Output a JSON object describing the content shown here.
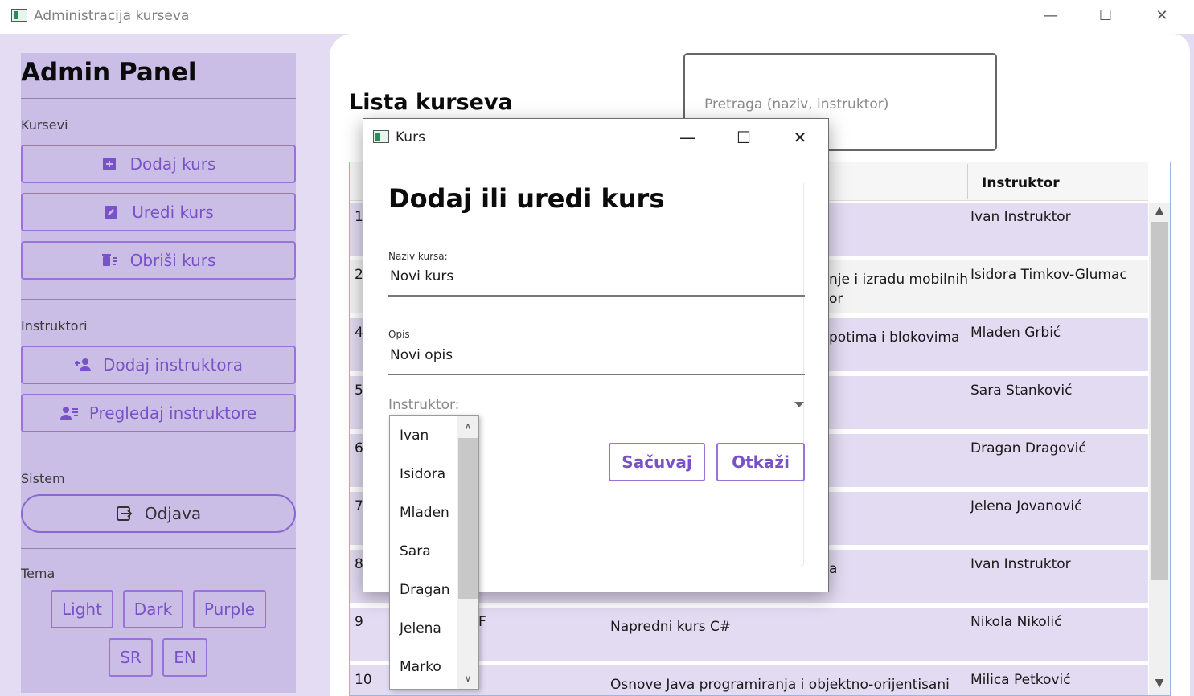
{
  "window": {
    "title": "Administracija kurseva",
    "minimize_glyph": "—",
    "maximize_glyph": "☐",
    "close_glyph": "✕"
  },
  "sidebar": {
    "title": "Admin Panel",
    "sections": {
      "courses": "Kursevi",
      "instructors": "Instruktori",
      "system": "Sistem",
      "theme": "Tema"
    },
    "buttons": {
      "add_course": "Dodaj kurs",
      "edit_course": "Uredi kurs",
      "delete_course": "Obriši kurs",
      "add_instructor": "Dodaj instruktora",
      "view_instructors": "Pregledaj instruktore",
      "logout": "Odjava"
    },
    "theme_buttons": [
      "Light",
      "Dark",
      "Purple"
    ],
    "language_buttons": [
      "SR",
      "EN"
    ],
    "icons": {
      "add_course": "plus-square-icon",
      "edit_course": "edit-icon",
      "delete_course": "delete-list-icon",
      "add_instructor": "person-add-icon",
      "view_instructors": "person-list-icon",
      "logout": "logout-icon"
    },
    "accent_color": "#7a52c8"
  },
  "main": {
    "list_title": "Lista kurseva",
    "search_placeholder": "Pretraga (naziv, instruktor)",
    "grid": {
      "instructor_header": "Instruktor",
      "rows": [
        {
          "id": "1",
          "course_fragment": "",
          "instructor": "Ivan Instruktor"
        },
        {
          "id": "2",
          "course_fragment": "nje i izradu mobilnih",
          "course_fragment2": "or",
          "instructor": "Isidora Timkov-Glumac"
        },
        {
          "id": "4",
          "course_fragment": "potima i blokovima",
          "instructor": "Mladen Grbić"
        },
        {
          "id": "5",
          "course_fragment": "",
          "instructor": "Sara Stanković"
        },
        {
          "id": "6",
          "course_fragment": "",
          "instructor": "Dragan Dragović"
        },
        {
          "id": "7",
          "course_fragment": "",
          "instructor": "Jelena Jovanović"
        },
        {
          "id": "8",
          "course_fragment": "a",
          "instructor": "Ivan Instruktor"
        },
        {
          "id": "9",
          "code_fragment": "F",
          "course_fragment": "Napredni kurs C#",
          "instructor": "Nikola Nikolić"
        },
        {
          "id": "10",
          "course_fragment": "Osnove Java programiranja i objektno-orijentisani",
          "instructor": "Milica Petković"
        }
      ]
    }
  },
  "dialog": {
    "title": "Kurs",
    "heading": "Dodaj ili uredi kurs",
    "name_label": "Naziv kursa:",
    "name_value": "Novi kurs",
    "desc_label": "Opis",
    "desc_value": "Novi opis",
    "instructor_label": "Instruktor:",
    "save_label": "Sačuvaj",
    "cancel_label": "Otkaži"
  },
  "dropdown": {
    "options": [
      "Ivan",
      "Isidora",
      "Mladen",
      "Sara",
      "Dragan",
      "Jelena",
      "Marko"
    ]
  }
}
